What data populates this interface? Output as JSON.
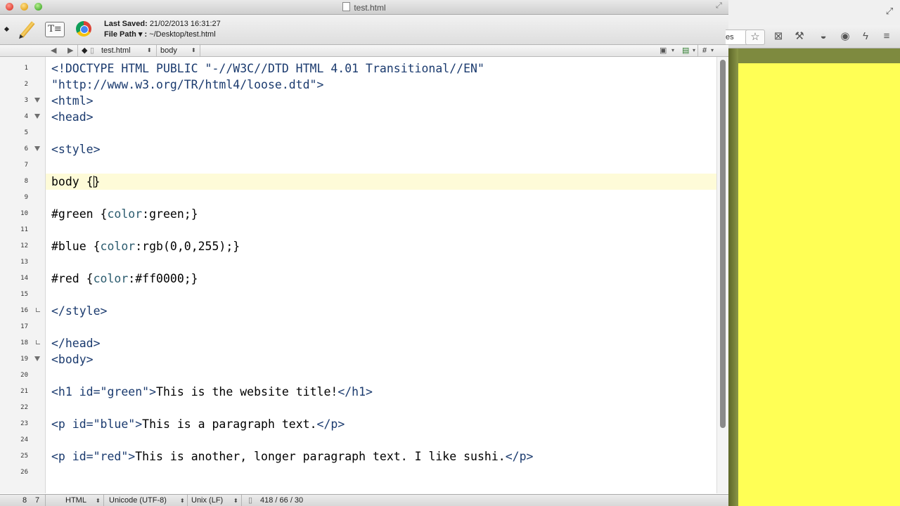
{
  "window": {
    "title": "test.html"
  },
  "toolbar": {
    "last_saved_label": "Last Saved:",
    "last_saved_value": "21/02/2013 16:31:27",
    "file_path_label": "File Path ▾ :",
    "file_path_value": "~/Desktop/test.html",
    "text_button": "T≡"
  },
  "navbar": {
    "file": "test.html",
    "symbol": "body",
    "hash": "#"
  },
  "lines": [
    {
      "n": "1",
      "html": "<span style=\"color:#1a3a6e\">&lt;!DOCTYPE HTML PUBLIC </span><span style=\"color:#1a3a6e\">\"-//W3C//DTD HTML 4.01 Transitional//EN\"</span>"
    },
    {
      "n": "2",
      "html": "<span style=\"color:#1a3a6e\">\"http://www.w3.org/TR/html4/loose.dtd\"&gt;</span>"
    },
    {
      "n": "3",
      "html": "<span style=\"color:#1a3a6e\">&lt;html&gt;</span>"
    },
    {
      "n": "4",
      "html": "<span style=\"color:#1a3a6e\">&lt;head&gt;</span>"
    },
    {
      "n": "5",
      "html": ""
    },
    {
      "n": "6",
      "html": "<span style=\"color:#1a3a6e\">&lt;style&gt;</span>"
    },
    {
      "n": "7",
      "html": ""
    },
    {
      "n": "8",
      "html": "body {<span class=\"caret\"></span>}"
    },
    {
      "n": "9",
      "html": ""
    },
    {
      "n": "10",
      "html": "#green {<span style=\"color:#2b5b6e\">color</span>:green;}"
    },
    {
      "n": "11",
      "html": ""
    },
    {
      "n": "12",
      "html": "#blue {<span style=\"color:#2b5b6e\">color</span>:rgb(0,0,255);}"
    },
    {
      "n": "13",
      "html": ""
    },
    {
      "n": "14",
      "html": "#red {<span style=\"color:#2b5b6e\">color</span>:#ff0000;}"
    },
    {
      "n": "15",
      "html": ""
    },
    {
      "n": "16",
      "html": "<span style=\"color:#1a3a6e\">&lt;/style&gt;</span>"
    },
    {
      "n": "17",
      "html": ""
    },
    {
      "n": "18",
      "html": "<span style=\"color:#1a3a6e\">&lt;/head&gt;</span>"
    },
    {
      "n": "19",
      "html": "<span style=\"color:#1a3a6e\">&lt;body&gt;</span>"
    },
    {
      "n": "20",
      "html": ""
    },
    {
      "n": "21",
      "html": "<span style=\"color:#1a3a6e\">&lt;h1 id=</span><span style=\"color:#1a3a6e\">\"green\"</span><span style=\"color:#1a3a6e\">&gt;</span>This is the website title!<span style=\"color:#1a3a6e\">&lt;/h1&gt;</span>"
    },
    {
      "n": "22",
      "html": ""
    },
    {
      "n": "23",
      "html": "<span style=\"color:#1a3a6e\">&lt;p id=</span><span style=\"color:#1a3a6e\">\"blue\"</span><span style=\"color:#1a3a6e\">&gt;</span>This is a paragraph text.<span style=\"color:#1a3a6e\">&lt;/p&gt;</span>"
    },
    {
      "n": "24",
      "html": ""
    },
    {
      "n": "25",
      "html": "<span style=\"color:#1a3a6e\">&lt;p id=</span><span style=\"color:#1a3a6e\">\"red\"</span><span style=\"color:#1a3a6e\">&gt;</span>This is another, longer paragraph text. I like sushi.<span style=\"color:#1a3a6e\">&lt;/p&gt;</span>"
    },
    {
      "n": "26",
      "html": ""
    }
  ],
  "status": {
    "line": "8",
    "col": "7",
    "language": "HTML",
    "encoding": "Unicode (UTF-8)",
    "line_endings": "Unix (LF)",
    "counts": "418 / 66 / 30"
  },
  "browser": {
    "address_tail": "es",
    "page_color": "#ffff55"
  }
}
